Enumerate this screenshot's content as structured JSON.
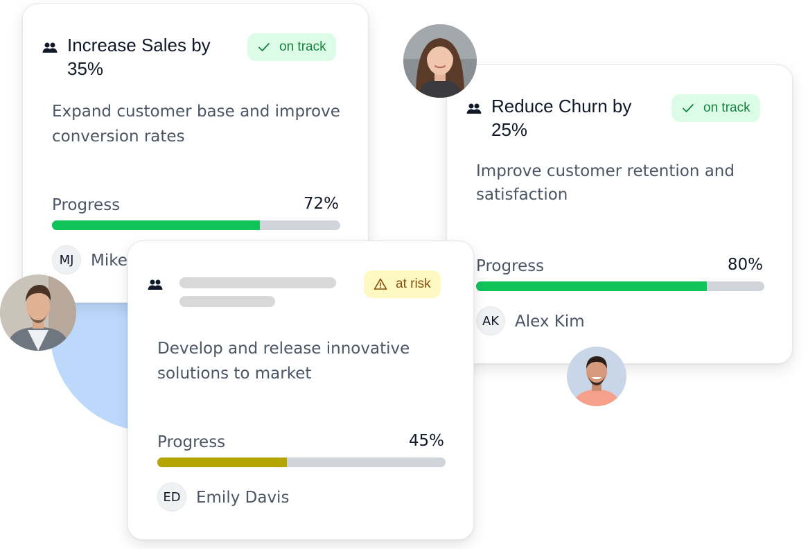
{
  "cards": [
    {
      "title": "Increase Sales by 35%",
      "status": "on track",
      "description": "Expand customer base and improve conversion rates",
      "progress_label": "Progress",
      "progress": 72,
      "progress_text": "72%",
      "owner_initials": "MJ",
      "owner_name": "Mike"
    },
    {
      "title": "Reduce Churn by 25%",
      "status": "on track",
      "description": "Improve customer retention and satisfaction",
      "progress_label": "Progress",
      "progress": 80,
      "progress_text": "80%",
      "owner_initials": "AK",
      "owner_name": "Alex Kim"
    },
    {
      "title": "",
      "status": "at risk",
      "description": "Develop and release innovative solutions to market",
      "progress_label": "Progress",
      "progress": 45,
      "progress_text": "45%",
      "owner_initials": "ED",
      "owner_name": "Emily Davis"
    }
  ],
  "colors": {
    "on_track_fill": "#10c45a",
    "at_risk_fill": "#b3a400",
    "track": "#d1d5db",
    "on_track_badge_bg": "#dcfce7",
    "on_track_badge_text": "#15803d",
    "at_risk_badge_bg": "#fef9c3",
    "at_risk_badge_text": "#854d0e",
    "accent_circle": "#bcd9fc"
  },
  "icons": {
    "team": "team-icon",
    "on_track": "check-icon",
    "at_risk": "warning-icon"
  }
}
